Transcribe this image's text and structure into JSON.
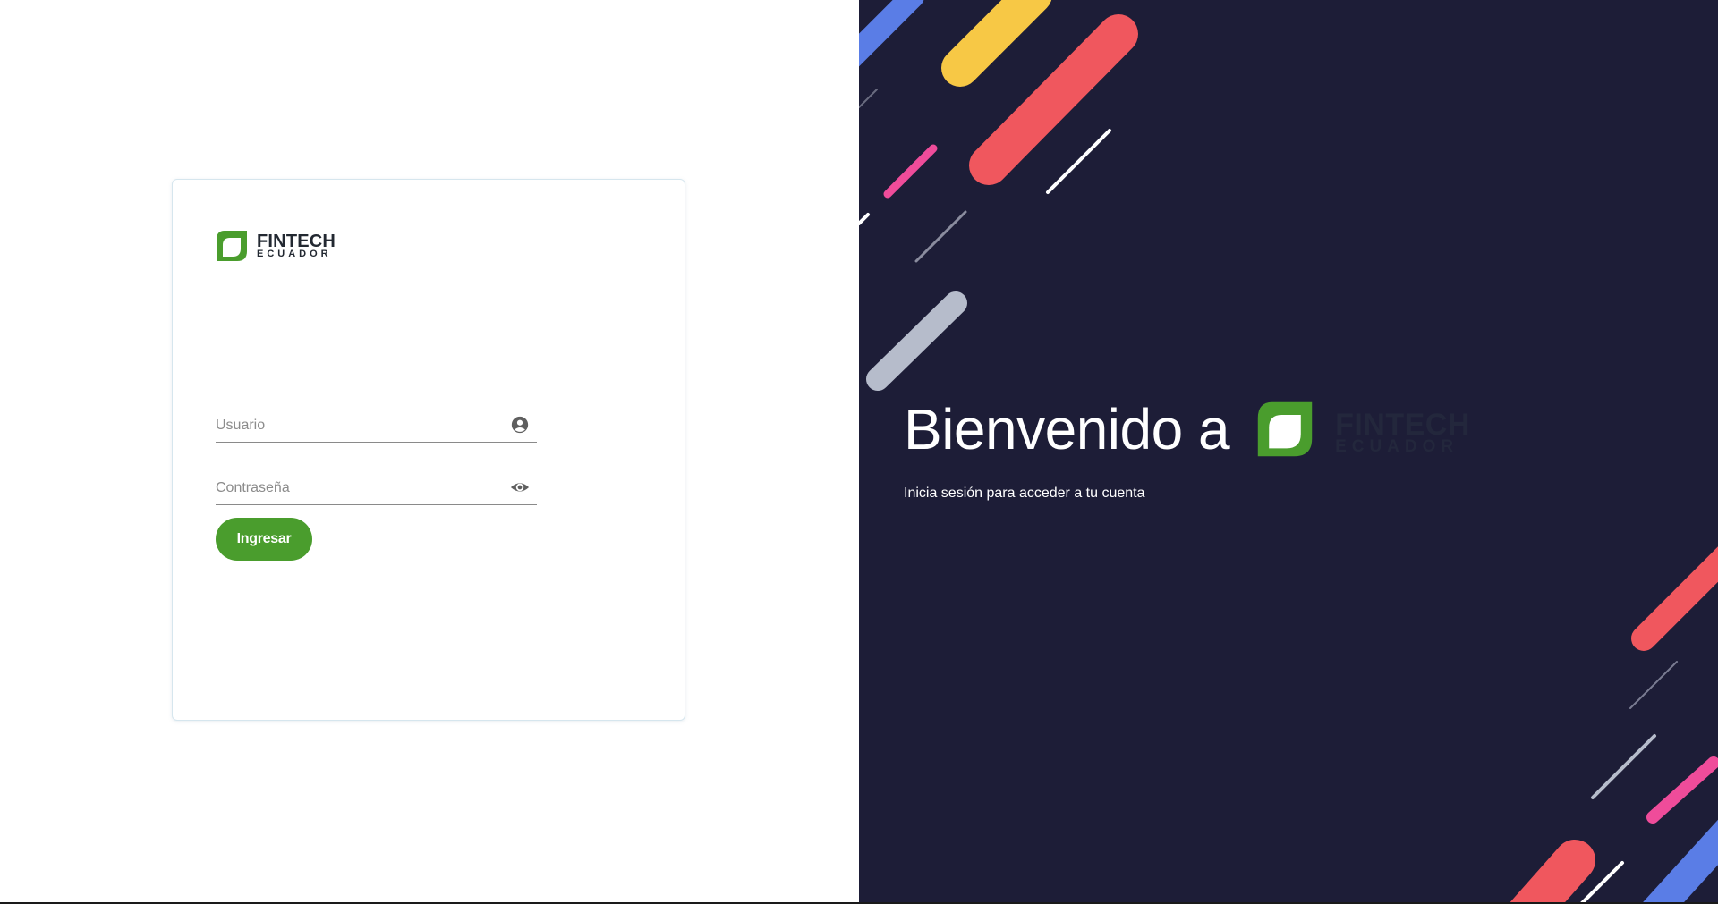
{
  "brand": {
    "name": "FINTECH",
    "sub": "ECUADOR",
    "logo_icon": "leaf-logo-icon",
    "logo_color": "#4a9d2d"
  },
  "login": {
    "username_placeholder": "Usuario",
    "username_icon": "account-circle-icon",
    "password_placeholder": "Contraseña",
    "password_icon": "eye-icon",
    "submit_label": "Ingresar",
    "submit_color": "#4a9d2d"
  },
  "welcome": {
    "title": "Bienvenido a",
    "subtitle": "Inicia sesión para acceder a tu cuenta",
    "background_color": "#1d1d37"
  }
}
